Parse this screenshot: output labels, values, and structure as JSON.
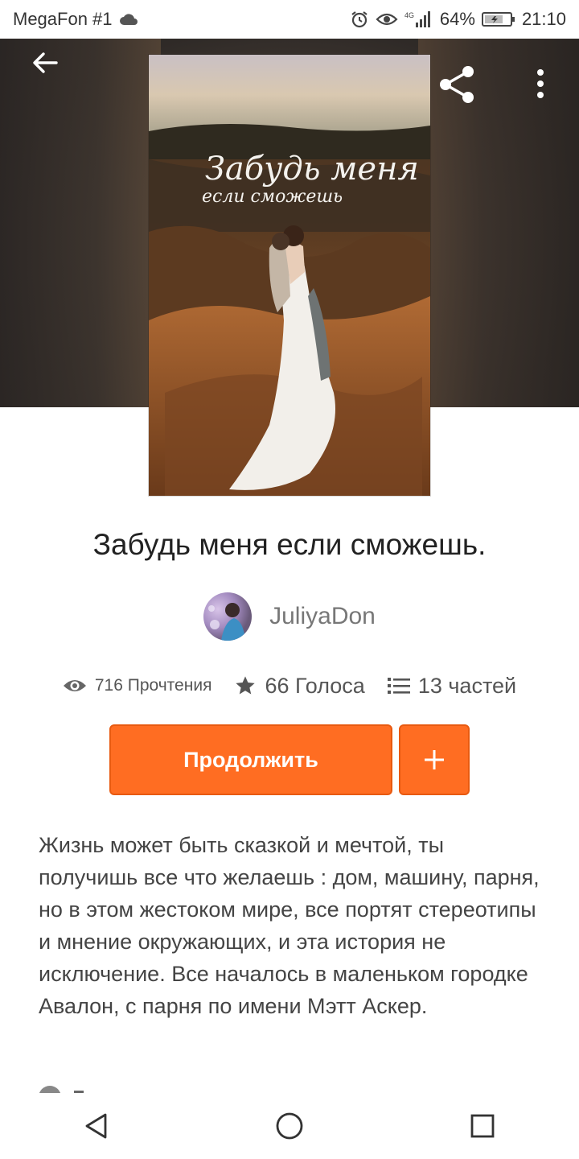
{
  "status_bar": {
    "carrier": "MegaFon #1",
    "network": "4G",
    "battery": "64%",
    "time": "21:10"
  },
  "toolbar": {
    "back_icon": "arrow-left-icon",
    "share_icon": "share-icon",
    "more_icon": "more-vertical-icon"
  },
  "cover": {
    "title_line1": "Забудь меня",
    "title_line2": "если сможешь"
  },
  "book": {
    "title": "Забудь меня если сможешь.",
    "author": "JuliyaDon",
    "stats": {
      "reads": "716 Прочтения",
      "votes": "66 Голоса",
      "parts": "13 частей"
    },
    "continue_label": "Продолжить",
    "add_label": "+",
    "description": "Жизнь может быть сказкой и мечтой, ты получишь все что желаешь : дом, машину, парня, но в этом жестоком мире, все портят стереотипы и мнение окружающих, и эта история не исключение. Все началось в маленьком городке Авалон, с парня по имени Мэтт Аскер."
  },
  "colors": {
    "accent": "#ff6d22",
    "hero_bg": "#3a322c"
  }
}
